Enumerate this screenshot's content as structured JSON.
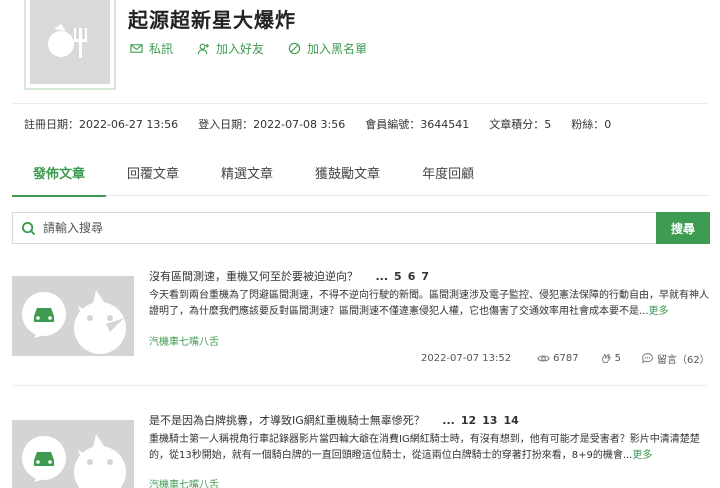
{
  "profile": {
    "username": "起源超新星大爆炸",
    "actions": {
      "message": "私訊",
      "add_friend": "加入好友",
      "blacklist": "加入黑名單"
    },
    "stats": {
      "register": "註冊日期：2022-06-27 13:56",
      "login": "登入日期：2022-07-08 3:56",
      "member_no": "會員編號：3644541",
      "points": "文章積分：5",
      "fans": "粉絲：0"
    }
  },
  "tabs": [
    "發佈文章",
    "回覆文章",
    "精選文章",
    "獲鼓勵文章",
    "年度回顧"
  ],
  "search": {
    "placeholder": "請輸入搜尋",
    "button": "搜尋"
  },
  "articles": [
    {
      "title": "沒有區間測速，重機又何至於要被迫逆向？",
      "pages": [
        "...",
        "5",
        "6",
        "7"
      ],
      "excerpt": "今天看到兩台重機為了閃避區間測速，不得不逆向行駛的新聞。區間測速涉及電子監控、侵犯憲法保障的行動自由，早就有神人證明了，為什麼我們應該要反對區間測速？區間測速不僅違憲侵犯人權，它也傷害了交通效率用社會成本要不是...",
      "more": "更多",
      "category": "汽機車七嘴八舌",
      "date": "2022-07-07 13:52",
      "views": "6787",
      "likes": "5",
      "comments": "留言（62）"
    },
    {
      "title": "是不是因為白牌挑釁，才導致IG網紅重機騎士無辜慘死？",
      "pages": [
        "...",
        "12",
        "13",
        "14"
      ],
      "excerpt": "重機騎士第一人稱視角行車記錄器影片當四輪大爺在消費IG網紅騎士時，有沒有想到，他有可能才是受害者？影片中清清楚楚的，從13秒開始，就有一個騎白牌的一直回頭瞪這位騎士，從這兩位白牌騎士的穿著打扮來看，8+9的機會...",
      "more": "更多",
      "category": "汽機車七嘴八舌"
    }
  ],
  "colors": {
    "accent": "#3e9b52"
  }
}
